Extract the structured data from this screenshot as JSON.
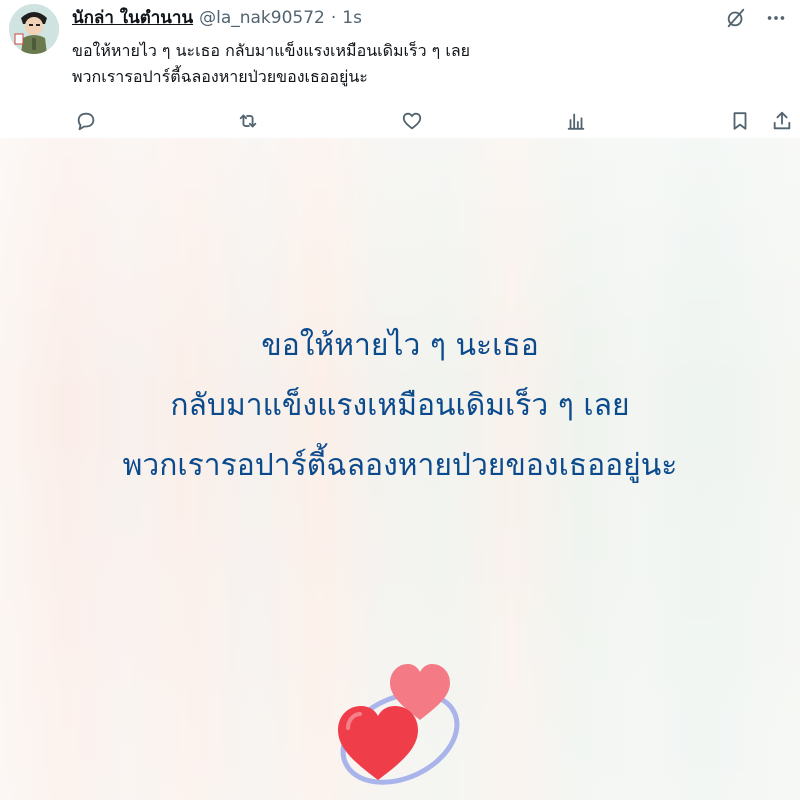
{
  "post": {
    "author": {
      "display_name": "นักล่า ในตำนาน",
      "handle": "@la_nak90572",
      "separator": "·",
      "time": "1s"
    },
    "header_icons": [
      "grok-icon",
      "more-icon"
    ],
    "text_lines": [
      "ขอให้หายไว ๆ นะเธอ กลับมาแข็งแรงเหมือนเดิมเร็ว ๆ เลย",
      "พวกเรารอปาร์ตี้ฉลองหายป่วยของเธออยู่นะ"
    ],
    "actions": [
      "reply-icon",
      "repost-icon",
      "like-icon",
      "views-icon",
      "bookmark-icon",
      "share-icon"
    ],
    "media": {
      "lines": [
        "ขอให้หายไว ๆ นะเธอ",
        "กลับมาแข็งแรงเหมือนเดิมเร็ว ๆ เลย",
        "พวกเรารอปาร์ตี้ฉลองหายป่วยของเธออยู่นะ"
      ],
      "text_color": "#0b4a8c",
      "decoration": "two-hearts-emoji"
    }
  },
  "colors": {
    "icon_gray": "#536471",
    "heart_red": "#ef3e4a",
    "heart_pink": "#f47a85",
    "swirl": "#a9b4ea"
  }
}
